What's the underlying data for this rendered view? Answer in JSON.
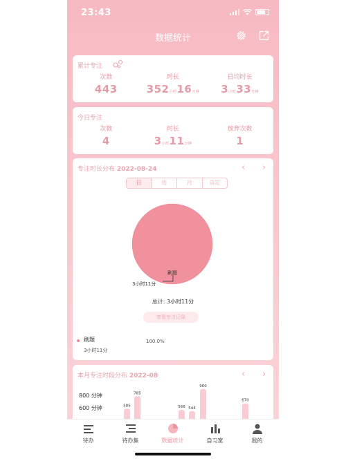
{
  "status_bar": {
    "time": "23:43"
  },
  "header": {
    "title": "数据统计"
  },
  "total_card": {
    "label": "累计专注",
    "stats": [
      {
        "header": "次数",
        "value": "443",
        "unit1": "",
        "value2": "",
        "unit2": ""
      },
      {
        "header": "时长",
        "value": "352",
        "unit1": "小时",
        "value2": "16",
        "unit2": "分钟"
      },
      {
        "header": "日均时长",
        "value": "3",
        "unit1": "小时",
        "value2": "33",
        "unit2": "分钟"
      }
    ]
  },
  "today_card": {
    "label": "今日专注",
    "stats": [
      {
        "header": "次数",
        "value": "4",
        "unit1": "",
        "value2": "",
        "unit2": ""
      },
      {
        "header": "时长",
        "value": "3",
        "unit1": "小时",
        "value2": "11",
        "unit2": "分钟"
      },
      {
        "header": "放弃次数",
        "value": "1",
        "unit1": "",
        "value2": "",
        "unit2": ""
      }
    ]
  },
  "distribution_card": {
    "label": "专注时长分布",
    "date": "2022-08-24",
    "prev_arrow": "‹",
    "next_arrow": "›",
    "segments": [
      "日",
      "周",
      "月",
      "自定"
    ],
    "active_segment": 0,
    "callout_name": "刷题",
    "callout_time": "3小时11分",
    "total": "总计: 3小时11分",
    "view_button": "查看专注记录",
    "legend": [
      {
        "name": "刷题",
        "time": "3小时11分",
        "percent": "100.0%",
        "color": "#ec8c9a"
      }
    ]
  },
  "month_card": {
    "label": "本月专注时段分布",
    "date": "2022-08",
    "prev_arrow": "‹",
    "next_arrow": "›"
  },
  "chart_data": {
    "type": "bar",
    "title": "",
    "y_tick_labels": [
      "800 分钟",
      "600 分钟"
    ],
    "y_tick_values": [
      800,
      600
    ],
    "ylim": [
      0,
      1000
    ],
    "bars": [
      {
        "value": 585,
        "label": "585"
      },
      {
        "value": 785,
        "label": "785"
      },
      {
        "value": 566,
        "label": "566"
      },
      {
        "value": 544,
        "label": "544"
      },
      {
        "value": 900,
        "label": "900"
      },
      {
        "value": 670,
        "label": "670"
      }
    ],
    "color": "#f9ccd3"
  },
  "tabbar": {
    "tabs": [
      {
        "label": "待办",
        "icon": "list-icon"
      },
      {
        "label": "待办集",
        "icon": "collection-icon"
      },
      {
        "label": "数据统计",
        "icon": "pie-chart-icon"
      },
      {
        "label": "自习室",
        "icon": "bar-chart-icon"
      },
      {
        "label": "我的",
        "icon": "person-icon"
      }
    ],
    "active_tab": 2
  },
  "colors": {
    "accent": "#ec95a1",
    "pie": "#f2919e",
    "background": "#f7b9c2"
  }
}
